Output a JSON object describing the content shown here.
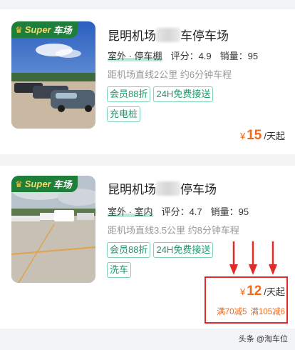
{
  "badge": {
    "super": "Super",
    "label": "车场",
    "icon": "crown-icon"
  },
  "listings": [
    {
      "title_pre": "昆明机场",
      "title_post": "车停车场",
      "type": "室外 · 停车棚",
      "rating_label": "评分：",
      "rating": "4.9",
      "sales_label": "销量：",
      "sales": "95",
      "distance": "距机场直线2公里 约6分钟车程",
      "tags": [
        "会员88折",
        "24H免费接送",
        "充电桩"
      ],
      "currency": "¥",
      "price": "15",
      "price_unit": "/天起"
    },
    {
      "title_pre": "昆明机场",
      "title_post": "停车场",
      "type": "室外 · 室内",
      "rating_label": "评分：",
      "rating": "4.7",
      "sales_label": "销量：",
      "sales": "95",
      "distance": "距机场直线3.5公里 约8分钟车程",
      "tags": [
        "会员88折",
        "24H免费接送",
        "洗车"
      ],
      "currency": "¥",
      "price": "12",
      "price_unit": "/天起",
      "promotions": [
        "满70减5",
        "满105减6"
      ]
    }
  ],
  "watermark": "头条 @淘车位",
  "colors": {
    "accent": "#f06a1e",
    "tag": "#1a9a6a",
    "annotation": "#e02b2b",
    "badge_bg": "#1f7f3a"
  }
}
